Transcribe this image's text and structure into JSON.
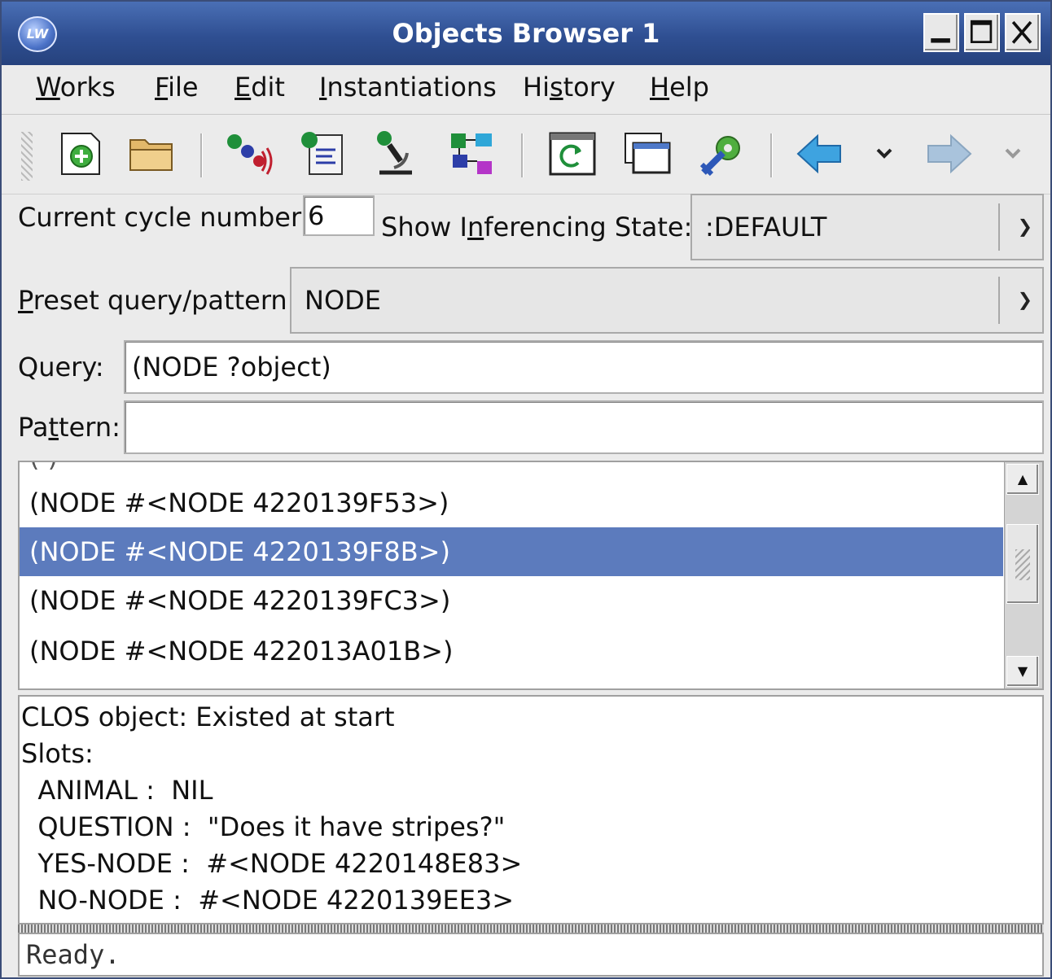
{
  "window": {
    "title": "Objects Browser 1",
    "logo_text": "LW",
    "controls": [
      "minimize",
      "maximize",
      "close"
    ]
  },
  "menubar": {
    "items": [
      {
        "label": "Works",
        "mnemonic": "W"
      },
      {
        "label": "File",
        "mnemonic": "F"
      },
      {
        "label": "Edit",
        "mnemonic": "E"
      },
      {
        "label": "Instantiations",
        "mnemonic": "I"
      },
      {
        "label": "History",
        "mnemonic": "s"
      },
      {
        "label": "Help",
        "mnemonic": "H"
      }
    ]
  },
  "toolbar": {
    "icons": [
      "new-icon",
      "open-folder-icon",
      "inspect-icon",
      "clipboard-icon",
      "microscope-icon",
      "class-browser-icon",
      "refresh-icon",
      "window-icon",
      "tools-icon",
      "back-arrow-icon",
      "back-history-dropdown",
      "forward-arrow-icon",
      "forward-history-dropdown"
    ]
  },
  "controls": {
    "cycle_label": "Current cycle number:",
    "cycle_value": "6",
    "inferencing_label": "Show Inferencing State:",
    "inferencing_value": ":DEFAULT",
    "preset_label": "Preset query/pattern:",
    "preset_value": "NODE",
    "query_label": "Query:",
    "query_value": "(NODE ?object)",
    "pattern_label": "Pattern:",
    "pattern_value": ""
  },
  "results": {
    "rows": [
      "(NODE #<NODE 4220139F53>)",
      "(NODE #<NODE 4220139F8B>)",
      "(NODE #<NODE 4220139FC3>)",
      "(NODE #<NODE 422013A01B>)"
    ],
    "selected_index": 1
  },
  "details": {
    "lines": [
      "CLOS object: Existed at start",
      "Slots:",
      "  ANIMAL :  NIL",
      "  QUESTION :  \"Does it have stripes?\"",
      "  YES-NODE :  #<NODE 4220148E83>",
      "  NO-NODE :  #<NODE 4220139EE3>"
    ]
  },
  "status": {
    "text": "Ready."
  },
  "colors": {
    "titlebar": "#2f4f92",
    "selection": "#5c7bbd",
    "background": "#ebebeb"
  }
}
